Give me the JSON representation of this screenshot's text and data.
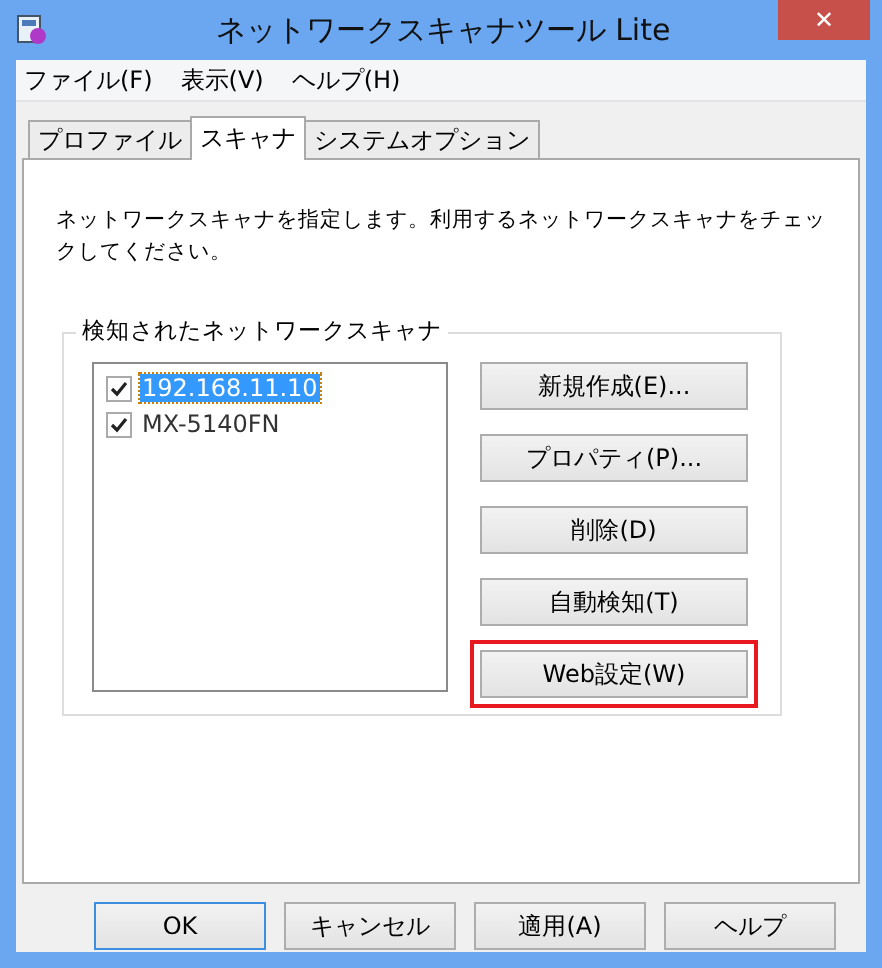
{
  "window": {
    "title": "ネットワークスキャナツール Lite",
    "close": "✕"
  },
  "menu": [
    "ファイル(F)",
    "表示(V)",
    "ヘルプ(H)"
  ],
  "tabs": [
    {
      "label": "プロファイル",
      "selected": false
    },
    {
      "label": "スキャナ",
      "selected": true
    },
    {
      "label": "システムオプション",
      "selected": false
    }
  ],
  "description": "ネットワークスキャナを指定します。利用するネットワークスキャナをチェックしてください。",
  "group": {
    "title": "検知されたネットワークスキャナ",
    "scanners": [
      {
        "name": "192.168.11.10",
        "checked": true,
        "selected": true
      },
      {
        "name": "MX-5140FN",
        "checked": true,
        "selected": false
      }
    ],
    "buttons": [
      {
        "label": "新規作成(E)...",
        "highlighted": false
      },
      {
        "label": "プロパティ(P)...",
        "highlighted": false
      },
      {
        "label": "削除(D)",
        "highlighted": false
      },
      {
        "label": "自動検知(T)",
        "highlighted": false
      },
      {
        "label": "Web設定(W)",
        "highlighted": true
      }
    ]
  },
  "footer_buttons": [
    {
      "label": "OK",
      "default": true
    },
    {
      "label": "キャンセル",
      "default": false
    },
    {
      "label": "適用(A)",
      "default": false
    },
    {
      "label": "ヘルプ",
      "default": false
    }
  ]
}
